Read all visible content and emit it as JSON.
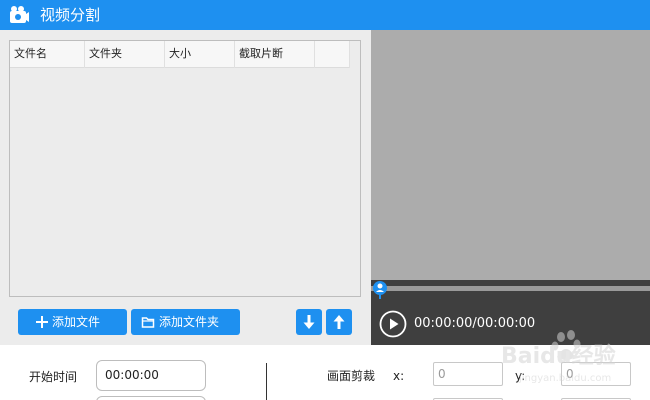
{
  "window": {
    "title": "视频分割"
  },
  "file_table": {
    "columns": [
      "文件名",
      "文件夹",
      "大小",
      "截取片断"
    ],
    "rows": []
  },
  "buttons": {
    "add_file": "添加文件",
    "add_folder": "添加文件夹"
  },
  "player": {
    "time": "00:00:00/00:00:00",
    "progress": 0
  },
  "settings": {
    "start_label": "开始时间",
    "start_value": "00:00:00",
    "crop_label": "画面剪裁",
    "x_label": "x:",
    "x_value": "0",
    "y_label": "y:",
    "y_value": "0"
  },
  "watermark": {
    "text": "Baidu经验",
    "subtext": "jingyan.baidu.com"
  },
  "colors": {
    "accent": "#1e90f0",
    "player_bg": "#3f3f3f",
    "preview_bg": "#acacac"
  },
  "icons": [
    "app-camera-icon",
    "plus-icon",
    "folder-icon",
    "arrow-down-icon",
    "arrow-up-icon",
    "play-icon",
    "seek-handle-icon"
  ]
}
